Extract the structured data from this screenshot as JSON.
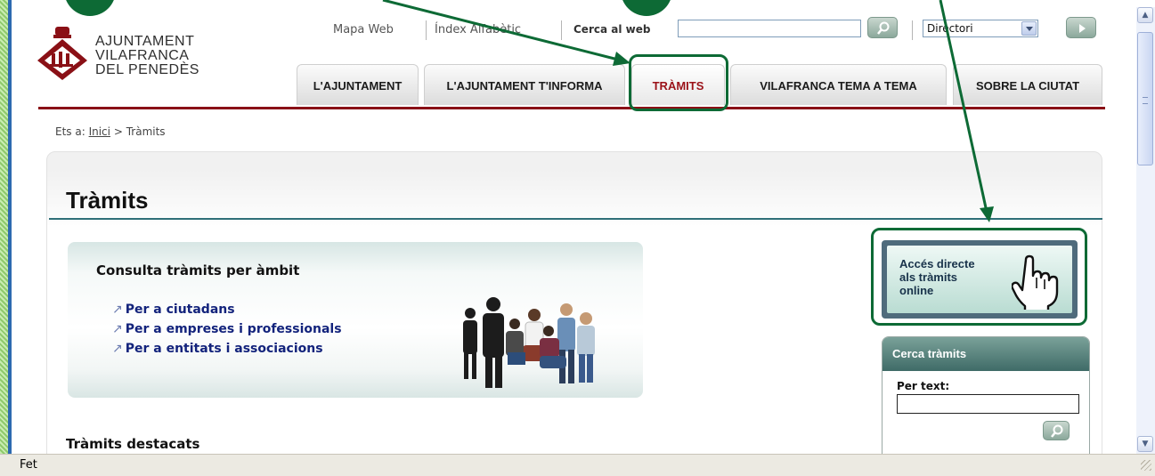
{
  "page": {
    "logo": {
      "lines": [
        "AJUNTAMENT",
        "VILAFRANCA",
        "DEL PENEDÈS"
      ]
    },
    "topbar": {
      "site_map": "Mapa Web",
      "alpha_index": "Índex Alfabètic",
      "web_search_label": "Cerca al web",
      "directory_value": "Directori"
    },
    "tabs": [
      {
        "label": "L'AJUNTAMENT"
      },
      {
        "label": "L'AJUNTAMENT T'INFORMA"
      },
      {
        "label": "TRÀMITS"
      },
      {
        "label": "VILAFRANCA TEMA A TEMA"
      },
      {
        "label": "SOBRE LA CIUTAT"
      }
    ],
    "active_tab": "TRÀMITS",
    "breadcrumb": {
      "prefix": "Ets a:",
      "home": "Inici",
      "separator": ">",
      "current": "Tràmits"
    },
    "title": "Tràmits",
    "promo": {
      "heading": "Consulta tràmits per àmbit",
      "links": [
        "Per a ciutadans",
        "Per a empreses i professionals",
        "Per a entitats i associacions"
      ]
    },
    "featured_heading": "Tràmits destacats",
    "online_access": {
      "line1": "Accés directe",
      "line2": "als tràmits",
      "line3": "online"
    },
    "search_panel": {
      "header": "Cerca tràmits",
      "text_label": "Per text:",
      "text_value": ""
    }
  },
  "statusbar": {
    "text": "Fet"
  },
  "colors": {
    "tab_rule": "#8a1016",
    "active_tab_text": "#9b1219",
    "heading_rule": "#2f6f78",
    "annotation_green": "#0d6a35",
    "link_blue": "#13237c"
  },
  "icons": [
    "search-icon",
    "play-icon",
    "pointing-hand-icon",
    "scroll-up-icon",
    "scroll-down-icon",
    "link-arrow-icon"
  ]
}
